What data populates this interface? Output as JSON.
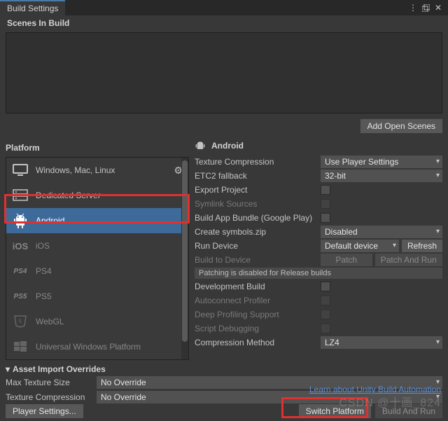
{
  "window": {
    "title": "Build Settings"
  },
  "sections": {
    "scenes": "Scenes In Build",
    "platform": "Platform",
    "overrides": "Asset Import Overrides"
  },
  "buttons": {
    "addOpenScenes": "Add Open Scenes",
    "playerSettings": "Player Settings...",
    "switchPlatform": "Switch Platform",
    "buildAndRun": "Build And Run",
    "refresh": "Refresh",
    "patch": "Patch",
    "patchAndRun": "Patch And Run"
  },
  "platforms": {
    "current": "Android",
    "items": [
      "Windows, Mac, Linux",
      "Dedicated Server",
      "Android",
      "iOS",
      "PS4",
      "PS5",
      "WebGL",
      "Universal Windows Platform"
    ]
  },
  "rightPanel": {
    "header": "Android",
    "textureCompression": {
      "label": "Texture Compression",
      "value": "Use Player Settings"
    },
    "etc2Fallback": {
      "label": "ETC2 fallback",
      "value": "32-bit"
    },
    "exportProject": {
      "label": "Export Project"
    },
    "symlinkSources": {
      "label": "Symlink Sources"
    },
    "buildAppBundle": {
      "label": "Build App Bundle (Google Play)"
    },
    "createSymbols": {
      "label": "Create symbols.zip",
      "value": "Disabled"
    },
    "runDevice": {
      "label": "Run Device",
      "value": "Default device"
    },
    "buildToDevice": {
      "label": "Build to Device"
    },
    "patchingDisabled": "Patching is disabled for Release builds",
    "developmentBuild": {
      "label": "Development Build"
    },
    "autoconnectProfiler": {
      "label": "Autoconnect Profiler"
    },
    "deepProfiling": {
      "label": "Deep Profiling Support"
    },
    "scriptDebugging": {
      "label": "Script Debugging"
    },
    "compressionMethod": {
      "label": "Compression Method",
      "value": "LZ4"
    }
  },
  "overrides": {
    "maxTextureSize": {
      "label": "Max Texture Size",
      "value": "No Override"
    },
    "textureCompression": {
      "label": "Texture Compression",
      "value": "No Override"
    }
  },
  "link": "Learn about Unity Build Automation",
  "watermark": "CSDN @十画_824"
}
